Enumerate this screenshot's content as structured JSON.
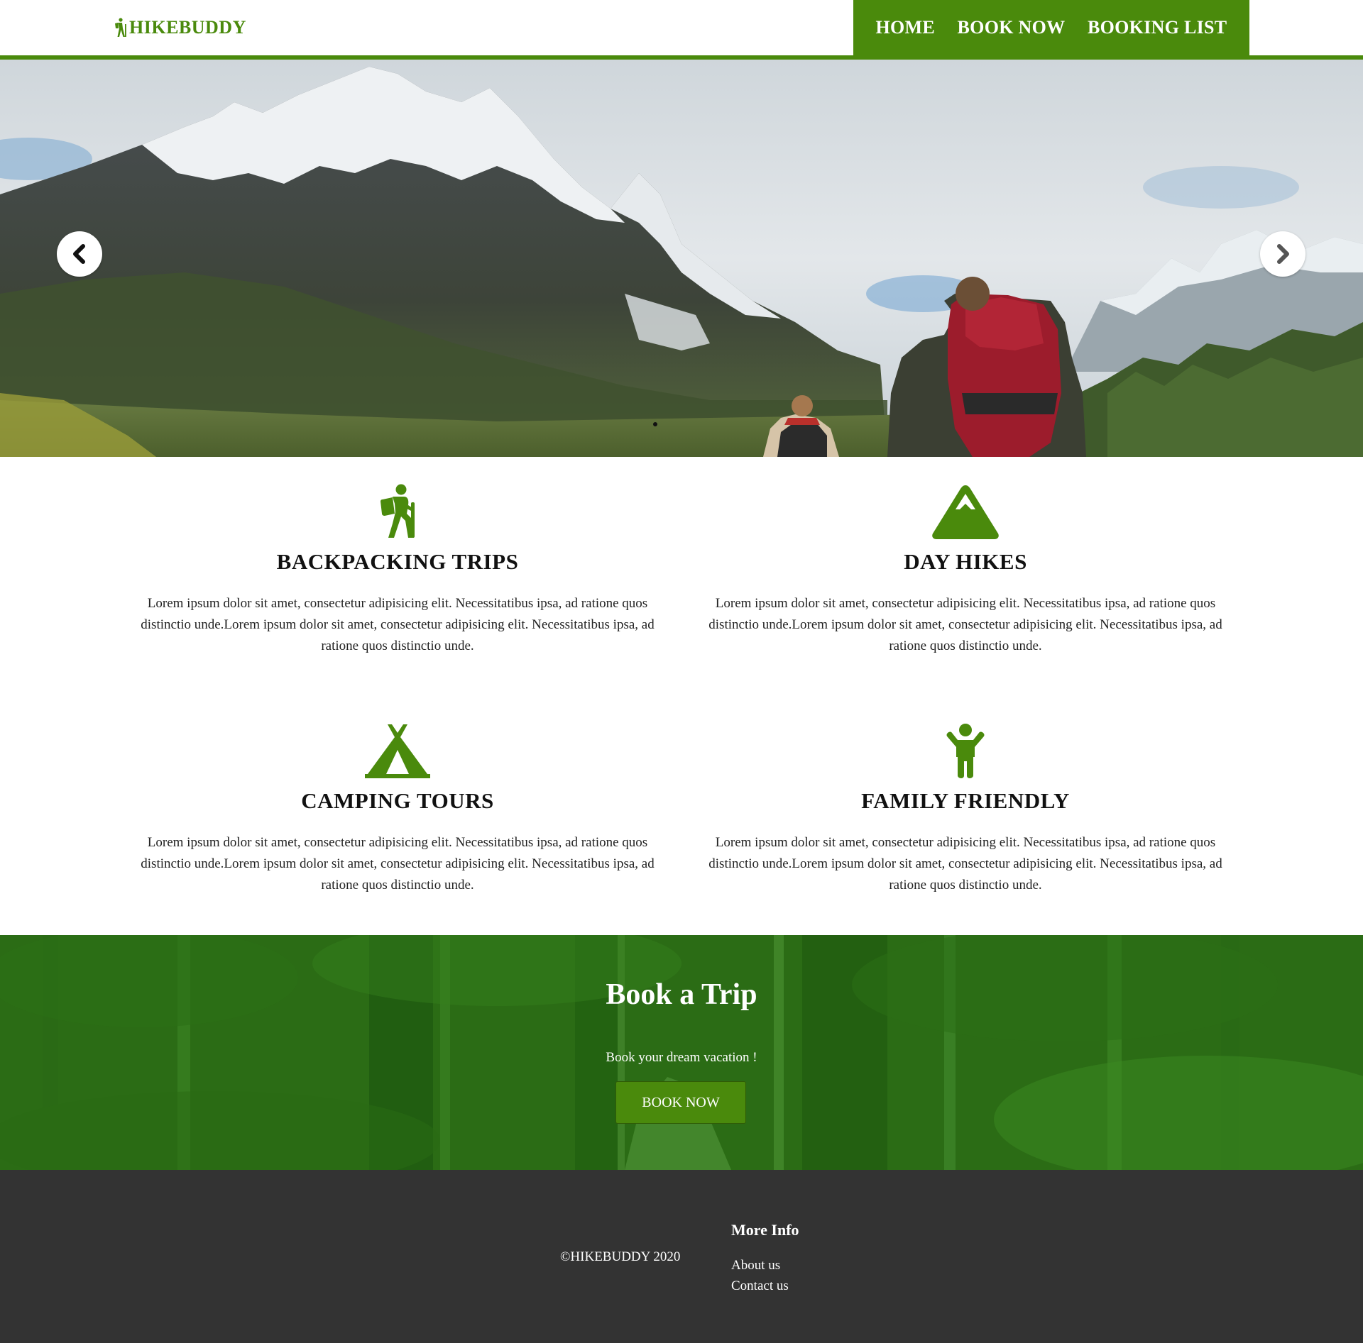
{
  "brand": {
    "name": "HIKEBUDDY",
    "color": "#4a8a0c"
  },
  "nav": {
    "items": [
      "HOME",
      "BOOK NOW",
      "BOOKING LIST"
    ]
  },
  "hero": {
    "slides_total": 1,
    "active_slide": 1,
    "prev_icon": "chevron-left-icon",
    "next_icon": "chevron-right-icon"
  },
  "features": [
    {
      "icon": "hiker-icon",
      "title": "BACKPACKING TRIPS",
      "text": "Lorem ipsum dolor sit amet, consectetur adipisicing elit. Necessitatibus ipsa, ad ratione quos distinctio unde.Lorem ipsum dolor sit amet, consectetur adipisicing elit. Necessitatibus ipsa, ad ratione quos distinctio unde."
    },
    {
      "icon": "mountain-icon",
      "title": "DAY HIKES",
      "text": "Lorem ipsum dolor sit amet, consectetur adipisicing elit. Necessitatibus ipsa, ad ratione quos distinctio unde.Lorem ipsum dolor sit amet, consectetur adipisicing elit. Necessitatibus ipsa, ad ratione quos distinctio unde."
    },
    {
      "icon": "tent-icon",
      "title": "CAMPING TOURS",
      "text": "Lorem ipsum dolor sit amet, consectetur adipisicing elit. Necessitatibus ipsa, ad ratione quos distinctio unde.Lorem ipsum dolor sit amet, consectetur adipisicing elit. Necessitatibus ipsa, ad ratione quos distinctio unde."
    },
    {
      "icon": "child-icon",
      "title": "FAMILY FRIENDLY",
      "text": "Lorem ipsum dolor sit amet, consectetur adipisicing elit. Necessitatibus ipsa, ad ratione quos distinctio unde.Lorem ipsum dolor sit amet, consectetur adipisicing elit. Necessitatibus ipsa, ad ratione quos distinctio unde."
    }
  ],
  "booking": {
    "title": "Book a Trip",
    "subtitle": "Book your dream vacation !",
    "button": "BOOK NOW"
  },
  "footer": {
    "copyright": "©HIKEBUDDY 2020",
    "more_info_title": "More Info",
    "links": [
      "About us",
      "Contact us"
    ]
  },
  "colors": {
    "accent": "#4a8a0c",
    "footer_bg": "#333333",
    "booking_overlay": "#2e7416"
  }
}
